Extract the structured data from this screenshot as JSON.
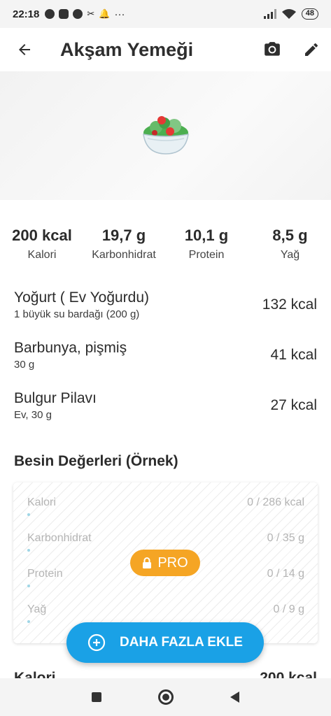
{
  "status": {
    "time": "22:18",
    "battery": "48"
  },
  "header": {
    "title": "Akşam Yemeği"
  },
  "macros": [
    {
      "value": "200 kcal",
      "label": "Kalori"
    },
    {
      "value": "19,7 g",
      "label": "Karbonhidrat"
    },
    {
      "value": "10,1 g",
      "label": "Protein"
    },
    {
      "value": "8,5 g",
      "label": "Yağ"
    }
  ],
  "foods": [
    {
      "name": "Yoğurt ( Ev Yoğurdu)",
      "portion": "1 büyük su bardağı (200 g)",
      "kcal": "132 kcal"
    },
    {
      "name": "Barbunya, pişmiş",
      "portion": "30 g",
      "kcal": "41 kcal"
    },
    {
      "name": "Bulgur Pilavı",
      "portion": "Ev, 30 g",
      "kcal": "27 kcal"
    }
  ],
  "nutrients": {
    "title": "Besin Değerleri (Örnek)",
    "rows": [
      {
        "name": "Kalori",
        "value": "0 / 286 kcal",
        "progress": 0
      },
      {
        "name": "Karbonhidrat",
        "value": "0 / 35 g",
        "progress": 0
      },
      {
        "name": "Protein",
        "value": "0 / 14 g",
        "progress": 0
      },
      {
        "name": "Yağ",
        "value": "0 / 9 g",
        "progress": 0
      }
    ],
    "pro_label": "PRO"
  },
  "add_more_label": "DAHA FAZLA EKLE",
  "partial_row": {
    "label": "Kalori",
    "value": "200 kcal"
  },
  "colors": {
    "accent": "#1aa1e6",
    "pro": "#f5a524",
    "progress": "#9fd6e6"
  },
  "icons": [
    "back-arrow-icon",
    "camera-icon",
    "edit-pencil-icon",
    "salad-icon",
    "lock-icon",
    "plus-circle-icon"
  ]
}
